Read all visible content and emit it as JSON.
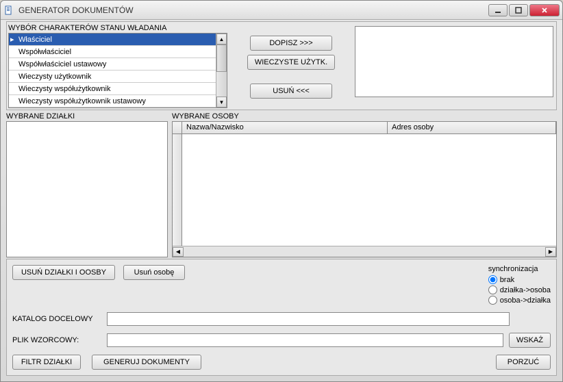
{
  "window": {
    "title": "GENERATOR DOKUMENTÓW"
  },
  "sections": {
    "char_label": "WYBÓR CHARAKTERÓW STANU WŁADANIA",
    "dzialki_label": "WYBRANE DZIAŁKI",
    "osoby_label": "WYBRANE OSOBY"
  },
  "char_list": [
    "Właściciel",
    "Współwłaściciel",
    "Współwłaściciel ustawowy",
    "Wieczysty użytkownik",
    "Wieczysty współużytkownik",
    "Wieczysty współużytkownik ustawowy"
  ],
  "buttons": {
    "dopisz": "DOPISZ >>>",
    "wieczyste": "WIECZYSTE UŻYTK.",
    "usun": "USUŃ <<<",
    "usun_dzialki": "USUŃ DZIAŁKI I OOSBY",
    "usun_osobe": "Usuń osobę",
    "wskaz": "WSKAŻ",
    "filtr": "FILTR DZIAŁKI",
    "generuj": "GENERUJ DOKUMENTY",
    "porzuc": "PORZUĆ"
  },
  "osoby_grid": {
    "col1": "Nazwa/Nazwisko",
    "col2": "Adres osoby"
  },
  "sync": {
    "title": "synchronizacja",
    "opt1": "brak",
    "opt2": "działka->osoba",
    "opt3": "osoba->działka",
    "selected": "brak"
  },
  "form": {
    "katalog_label": "KATALOG DOCELOWY",
    "katalog_value": "",
    "plik_label": "PLIK WZORCOWY:",
    "plik_value": ""
  },
  "notes": ""
}
